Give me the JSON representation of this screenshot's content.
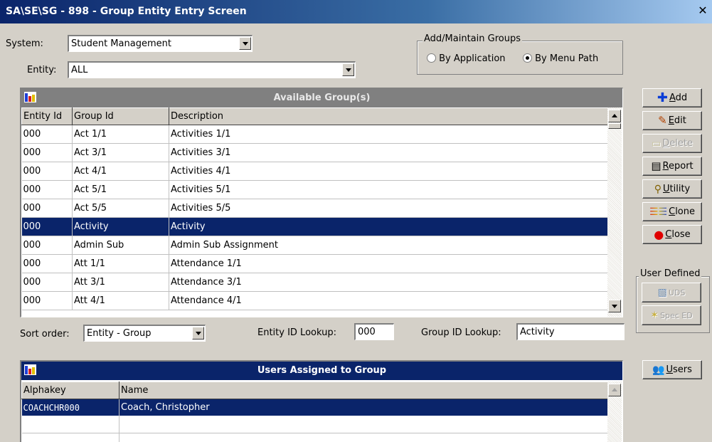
{
  "window": {
    "title": "SA\\SE\\SG - 898 - Group Entity Entry Screen",
    "close_glyph": "✕"
  },
  "filters": {
    "system_label": "System:",
    "system_value": "Student Management",
    "entity_label": "Entity:",
    "entity_value": "ALL"
  },
  "add_maintain": {
    "title": "Add/Maintain Groups",
    "by_application": "By Application",
    "by_menu_path": "By Menu Path",
    "selected": "By Menu Path"
  },
  "available_groups": {
    "title": "Available Group(s)",
    "columns": [
      "Entity Id",
      "Group Id",
      "Description"
    ],
    "rows": [
      [
        "000",
        "Act 1/1",
        "Activities 1/1"
      ],
      [
        "000",
        "Act 3/1",
        "Activities 3/1"
      ],
      [
        "000",
        "Act 4/1",
        "Activities 4/1"
      ],
      [
        "000",
        "Act 5/1",
        "Activities 5/1"
      ],
      [
        "000",
        "Act 5/5",
        "Activities 5/5"
      ],
      [
        "000",
        "Activity",
        "Activity"
      ],
      [
        "000",
        "Admin Sub",
        "Admin Sub Assignment"
      ],
      [
        "000",
        "Att 1/1",
        "Attendance 1/1"
      ],
      [
        "000",
        "Att 3/1",
        "Attendance 3/1"
      ],
      [
        "000",
        "Att 4/1",
        "Attendance 4/1"
      ]
    ],
    "selected_row": 5
  },
  "lookups": {
    "sort_label": "Sort order:",
    "sort_value": "Entity - Group",
    "entity_lookup_label": "Entity ID Lookup:",
    "entity_lookup_value": "000",
    "group_lookup_label": "Group ID Lookup:",
    "group_lookup_value": "Activity"
  },
  "buttons": {
    "add": "Add",
    "edit": "Edit",
    "delete": "Delete",
    "report": "Report",
    "utility": "Utility",
    "clone": "Clone",
    "close": "Close",
    "user_defined_title": "User Defined",
    "uds": "UDS",
    "spec_ed": "Spec ED",
    "users": "Users"
  },
  "users_assigned": {
    "title": "Users Assigned to Group",
    "columns": [
      "Alphakey",
      "Name"
    ],
    "rows": [
      [
        "COACHCHR000",
        "Coach, Christopher"
      ]
    ],
    "selected_row": 0
  },
  "colors": {
    "title_gradient_start": "#0a246a",
    "panel_header_dark": "#808080",
    "panel_header_navy": "#0a246a",
    "selection": "#0a246a",
    "add_icon": "#0a3dd6",
    "close_icon": "#e00000"
  }
}
